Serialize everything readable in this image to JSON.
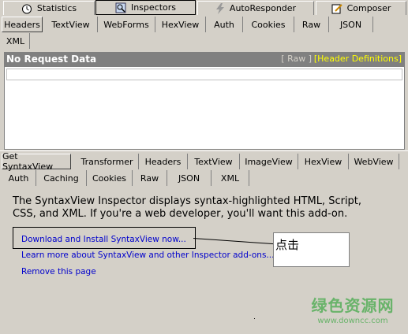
{
  "top_tabs": [
    {
      "label": "Statistics",
      "icon": "stopwatch-icon"
    },
    {
      "label": "Inspectors",
      "icon": "inspect-icon"
    },
    {
      "label": "AutoResponder",
      "icon": "lightning-icon"
    },
    {
      "label": "Composer",
      "icon": "compose-icon"
    }
  ],
  "request_tabs": [
    "Headers",
    "TextView",
    "WebForms",
    "HexView",
    "Auth",
    "Cookies",
    "Raw",
    "JSON",
    "XML"
  ],
  "request_panel": {
    "title": "No Request Data",
    "raw_link": "[ Raw ]",
    "header_defs_link": "[Header Definitions]"
  },
  "response_tabs_row1": [
    "Get SyntaxView",
    "Transformer",
    "Headers",
    "TextView",
    "ImageView",
    "HexView",
    "WebView"
  ],
  "response_tabs_row2": [
    "Auth",
    "Caching",
    "Cookies",
    "Raw",
    "JSON",
    "XML"
  ],
  "syntaxview": {
    "intro": "The SyntaxView Inspector displays syntax-highlighted HTML, Script, CSS, and XML. If you're a web developer, you'll want this add-on.",
    "download_link": "Download and Install SyntaxView now...",
    "learn_more_link": "Learn more about SyntaxView and other Inspector add-ons...",
    "remove_link": "Remove this page"
  },
  "annotation": {
    "callout_text": "点击"
  },
  "watermark": {
    "text": "绿色资源网",
    "url": "www.downcc.com"
  },
  "colors": {
    "header_bg": "#808080",
    "link": "#0000cc",
    "header_def": "#ffff00",
    "watermark": "#69b36a"
  }
}
